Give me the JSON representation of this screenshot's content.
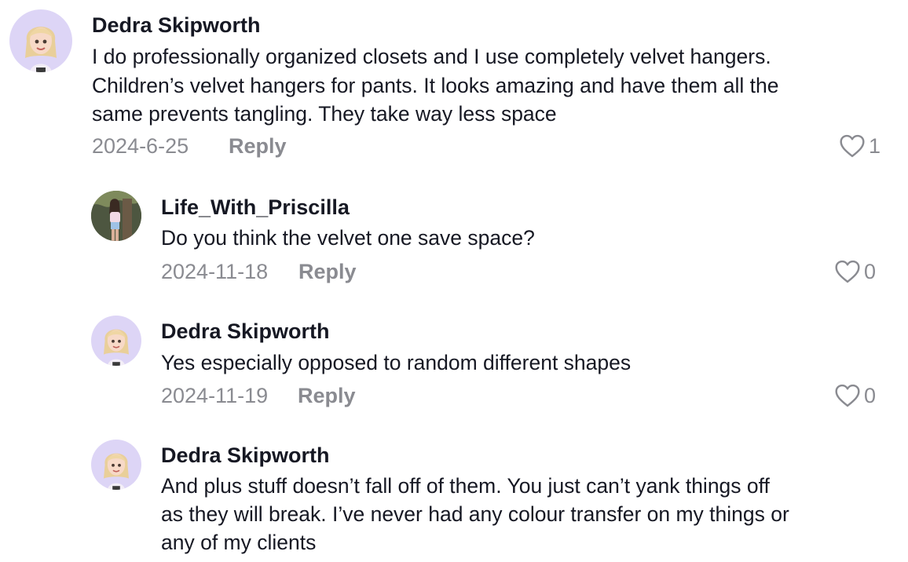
{
  "comments": [
    {
      "username": "Dedra Skipworth",
      "avatar_icon": "cartoon-blonde-girl-avatar",
      "text_lines": [
        "I do professionally organized closets and I use completely velvet hangers.",
        "Children’s velvet hangers for pants. It looks amazing and have them all the",
        "same prevents tangling. They take way less space"
      ],
      "date": "2024-6-25",
      "reply_label": "Reply",
      "likes": "1"
    },
    {
      "username": "Life_With_Priscilla",
      "avatar_icon": "photo-woman-tree-avatar",
      "text_lines": [
        "Do you think the velvet one save space?"
      ],
      "date": "2024-11-18",
      "reply_label": "Reply",
      "likes": "0"
    },
    {
      "username": "Dedra Skipworth",
      "avatar_icon": "cartoon-blonde-girl-avatar",
      "text_lines": [
        "Yes especially opposed to random different shapes"
      ],
      "date": "2024-11-19",
      "reply_label": "Reply",
      "likes": "0"
    },
    {
      "username": "Dedra Skipworth",
      "avatar_icon": "cartoon-blonde-girl-avatar",
      "text_lines": [
        "And plus stuff doesn’t fall off of them. You just can’t yank things off",
        "as they will break. I’ve never had any colour transfer on my things or",
        "any of my clients"
      ]
    }
  ],
  "colors": {
    "text": "#161823",
    "secondary": "#8a8b91",
    "avatar_bg": "#ddd5f6"
  }
}
